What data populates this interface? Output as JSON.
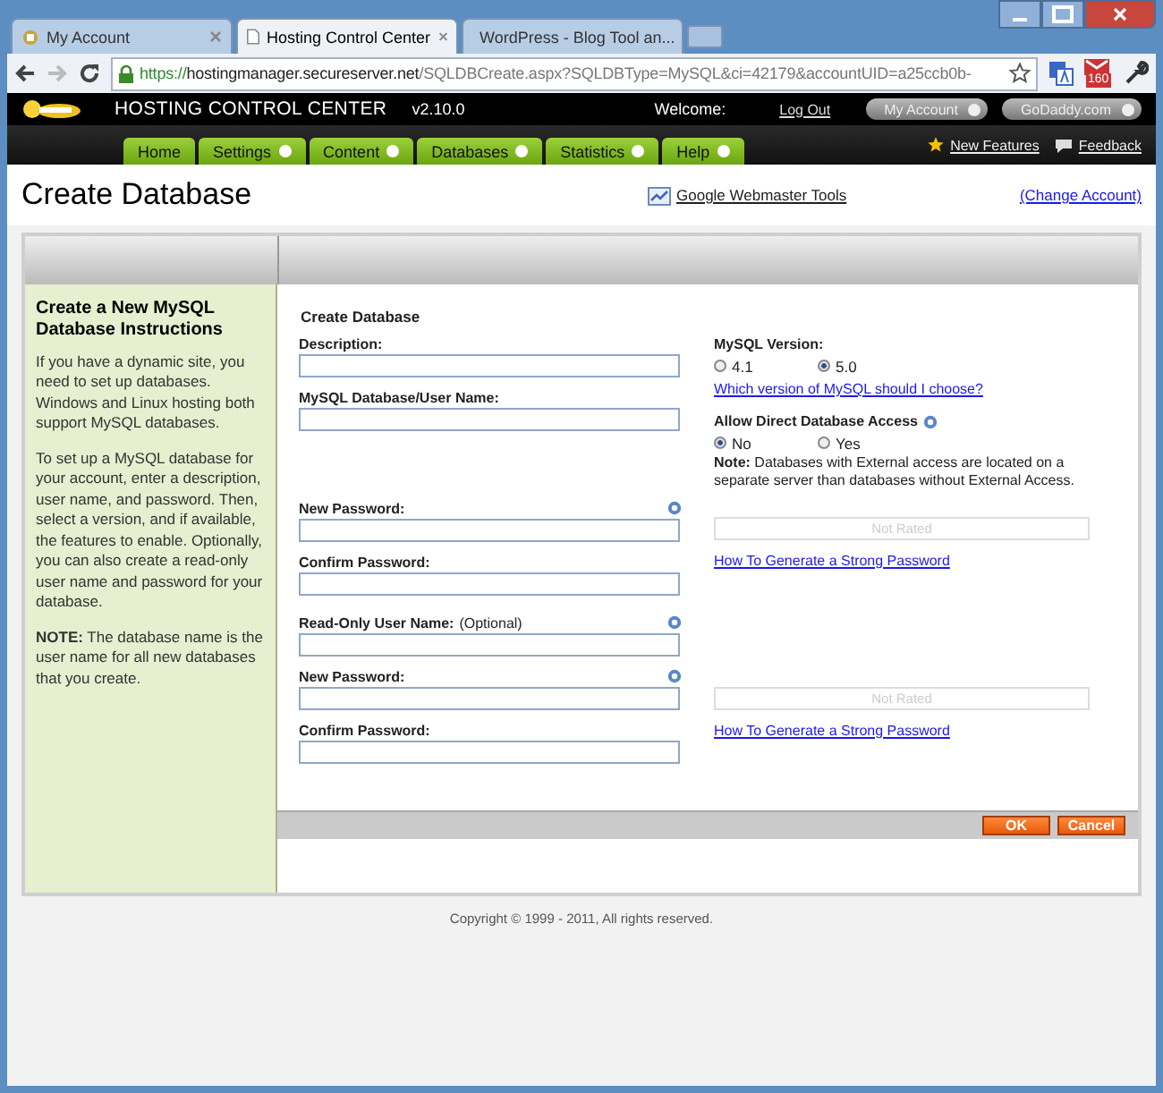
{
  "browser": {
    "tabs": [
      {
        "title": "My Account",
        "selected": false
      },
      {
        "title": "Hosting Control Center",
        "selected": true
      },
      {
        "title": "WordPress - Blog Tool an...",
        "selected": false
      }
    ],
    "url": {
      "scheme": "https://",
      "host": "hostingmanager.secureserver.net",
      "path": "/SQLDBCreate.aspx?SQLDBType=MySQL&ci=42179&accountUID=a25ccb0b-"
    },
    "mail_badge": "160"
  },
  "header": {
    "product": "HOSTING CONTROL CENTER",
    "version": "v2.10.0",
    "welcome": "Welcome:",
    "logout": "Log Out",
    "buttons": [
      "My Account",
      "GoDaddy.com"
    ]
  },
  "nav": {
    "tabs": [
      {
        "label": "Home",
        "arrow": false
      },
      {
        "label": "Settings",
        "arrow": true
      },
      {
        "label": "Content",
        "arrow": true
      },
      {
        "label": "Databases",
        "arrow": true
      },
      {
        "label": "Statistics",
        "arrow": true
      },
      {
        "label": "Help",
        "arrow": true
      }
    ],
    "links": [
      {
        "label": "New Features"
      },
      {
        "label": "Feedback"
      }
    ]
  },
  "page": {
    "title": "Create Database",
    "tools_link": "Google Webmaster Tools",
    "account_link": "(Change Account)"
  },
  "sidebar": {
    "title": "Create a New MySQL Database Instructions",
    "paragraphs": [
      "If you have a dynamic site, you need to set up databases. Windows and Linux hosting both support MySQL databases.",
      "To set up a MySQL database for your account, enter a description, user name, and password. Then, select a version, and if available, the features to enable. Optionally, you can also create a read-only user name and password for your database.",
      "**NOTE:** The database name is the user name for all new databases that you create."
    ]
  },
  "form": {
    "heading": "Create Database",
    "groups": [
      {
        "fields": [
          {
            "label": "Description:",
            "help": false
          },
          {
            "label": "MySQL Database/User Name:",
            "help": false
          }
        ],
        "right": {
          "kind": "options",
          "version_label": "MySQL Version:",
          "versions": [
            {
              "label": "4.1",
              "selected": false
            },
            {
              "label": "5.0",
              "selected": true
            }
          ],
          "version_link": "Which version of MySQL should I choose?",
          "access_label": "Allow Direct Database Access",
          "access": [
            {
              "label": "No",
              "selected": true
            },
            {
              "label": "Yes",
              "selected": false
            }
          ],
          "note": "**Note:** Databases with External access are located on a separate server than databases without External Access."
        }
      },
      {
        "fields": [
          {
            "label": "New Password:",
            "help": true
          },
          {
            "label": "Confirm Password:",
            "help": false
          }
        ],
        "right": {
          "kind": "strength",
          "meter": "Not Rated",
          "link": "How To Generate a Strong Password"
        }
      },
      {
        "fields": [
          {
            "label": "Read-Only User Name:",
            "note": "(Optional)",
            "help": true
          },
          {
            "label": "New Password:",
            "help": true
          },
          {
            "label": "Confirm Password:",
            "help": false
          }
        ],
        "right": {
          "kind": "strength",
          "meter": "Not Rated",
          "link": "How To Generate a Strong Password"
        }
      }
    ],
    "buttons": [
      "OK",
      "Cancel"
    ]
  },
  "footer": "Copyright © 1999 - 2011, All rights reserved."
}
